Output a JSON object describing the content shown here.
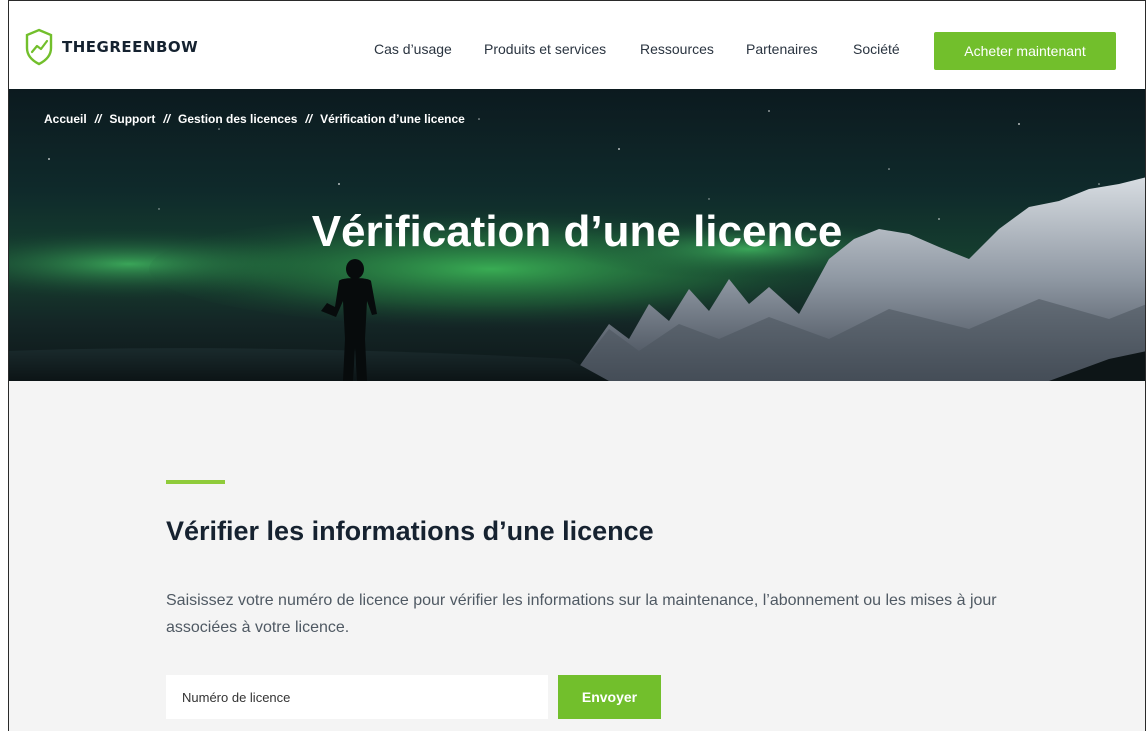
{
  "header": {
    "brand": "THEGREENBOW",
    "nav": [
      {
        "label": "Cas d’usage"
      },
      {
        "label": "Produits et services"
      },
      {
        "label": "Ressources"
      },
      {
        "label": "Partenaires"
      },
      {
        "label": "Société"
      }
    ],
    "cta_label": "Acheter maintenant"
  },
  "hero": {
    "breadcrumb": [
      {
        "label": "Accueil"
      },
      {
        "label": "Support"
      },
      {
        "label": "Gestion des licences"
      },
      {
        "label": "Vérification d’une licence"
      }
    ],
    "separator": "//",
    "title": "Vérification d’une licence"
  },
  "main": {
    "section_title": "Vérifier les informations d’une licence",
    "description": "Saisissez votre numéro de licence pour vérifier les informations sur la maintenance, l’abonnement ou les mises à jour associées à votre licence.",
    "input_placeholder": "Numéro de licence",
    "input_value": "",
    "submit_label": "Envoyer"
  },
  "colors": {
    "brand_green": "#72bf2c",
    "accent_green": "#8fcb3a",
    "text_dark": "#162230"
  },
  "icons": {
    "logo": "shield-chart-logo-icon"
  }
}
